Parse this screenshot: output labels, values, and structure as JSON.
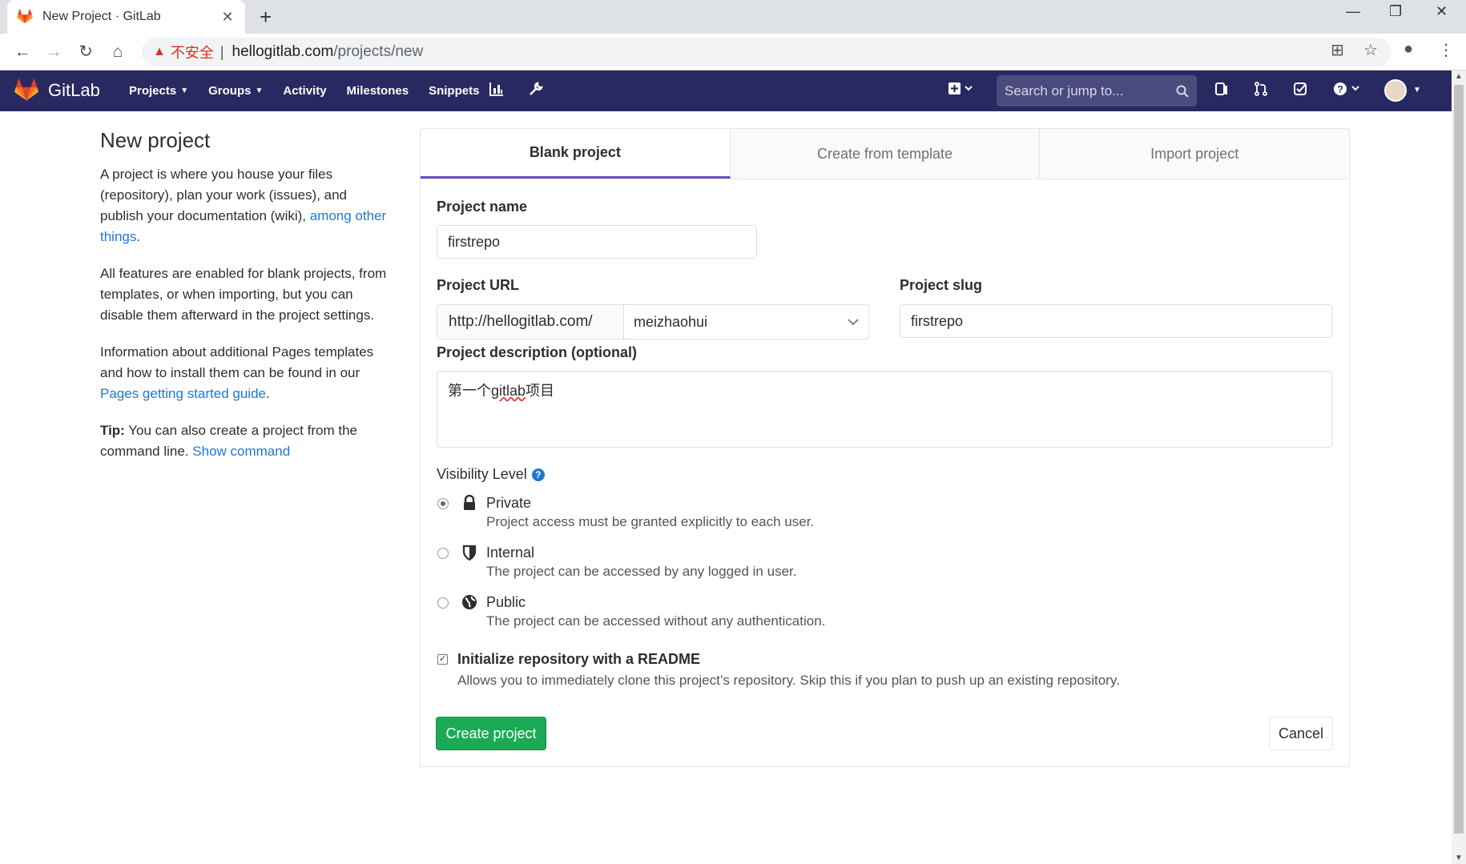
{
  "browser": {
    "tab_title": "New Project · GitLab",
    "tab_close": "✕",
    "new_tab": "+",
    "security_label": "不安全",
    "url_host": "hellogitlab.com",
    "url_path": "/projects/new"
  },
  "navbar": {
    "brand": "GitLab",
    "menu": [
      {
        "label": "Projects",
        "dropdown": true
      },
      {
        "label": "Groups",
        "dropdown": true
      },
      {
        "label": "Activity"
      },
      {
        "label": "Milestones"
      },
      {
        "label": "Snippets"
      }
    ],
    "search_placeholder": "Search or jump to..."
  },
  "sidebar": {
    "title": "New project",
    "para1_text": "A project is where you house your files (repository), plan your work (issues), and publish your documentation (wiki), ",
    "para1_link": "among other things",
    "para1_end": ".",
    "para2": "All features are enabled for blank projects, from templates, or when importing, but you can disable them afterward in the project settings.",
    "para3_text": "Information about additional Pages templates and how to install them can be found in our ",
    "para3_link": "Pages getting started guide",
    "para3_end": ".",
    "tip_label": "Tip:",
    "tip_text": " You can also create a project from the command line. ",
    "tip_link": "Show command"
  },
  "tabs": [
    "Blank project",
    "Create from template",
    "Import project"
  ],
  "form": {
    "project_name_label": "Project name",
    "project_name_value": "firstrepo",
    "project_url_label": "Project URL",
    "project_url_prefix": "http://hellogitlab.com/",
    "namespace_value": "meizhaohui",
    "project_slug_label": "Project slug",
    "project_slug_value": "firstrepo",
    "description_label": "Project description (optional)",
    "description_pre": "第一个",
    "description_mid": "gitlab",
    "description_post": "项目",
    "visibility_label": "Visibility Level",
    "visibility_help": "?",
    "visibility_options": [
      {
        "title": "Private",
        "desc": "Project access must be granted explicitly to each user.",
        "selected": true,
        "icon": "lock-icon"
      },
      {
        "title": "Internal",
        "desc": "The project can be accessed by any logged in user.",
        "selected": false,
        "icon": "shield-icon"
      },
      {
        "title": "Public",
        "desc": "The project can be accessed without any authentication.",
        "selected": false,
        "icon": "globe-icon"
      }
    ],
    "readme_label": "Initialize repository with a README",
    "readme_desc": "Allows you to immediately clone this project’s repository. Skip this if you plan to push up an existing repository.",
    "readme_checked": true,
    "create_button": "Create project",
    "cancel_button": "Cancel"
  },
  "colors": {
    "nav_bg": "#292961",
    "accent": "#6b4fbb",
    "link": "#1f78d1",
    "success": "#1aaa55",
    "warning": "#d93025"
  }
}
